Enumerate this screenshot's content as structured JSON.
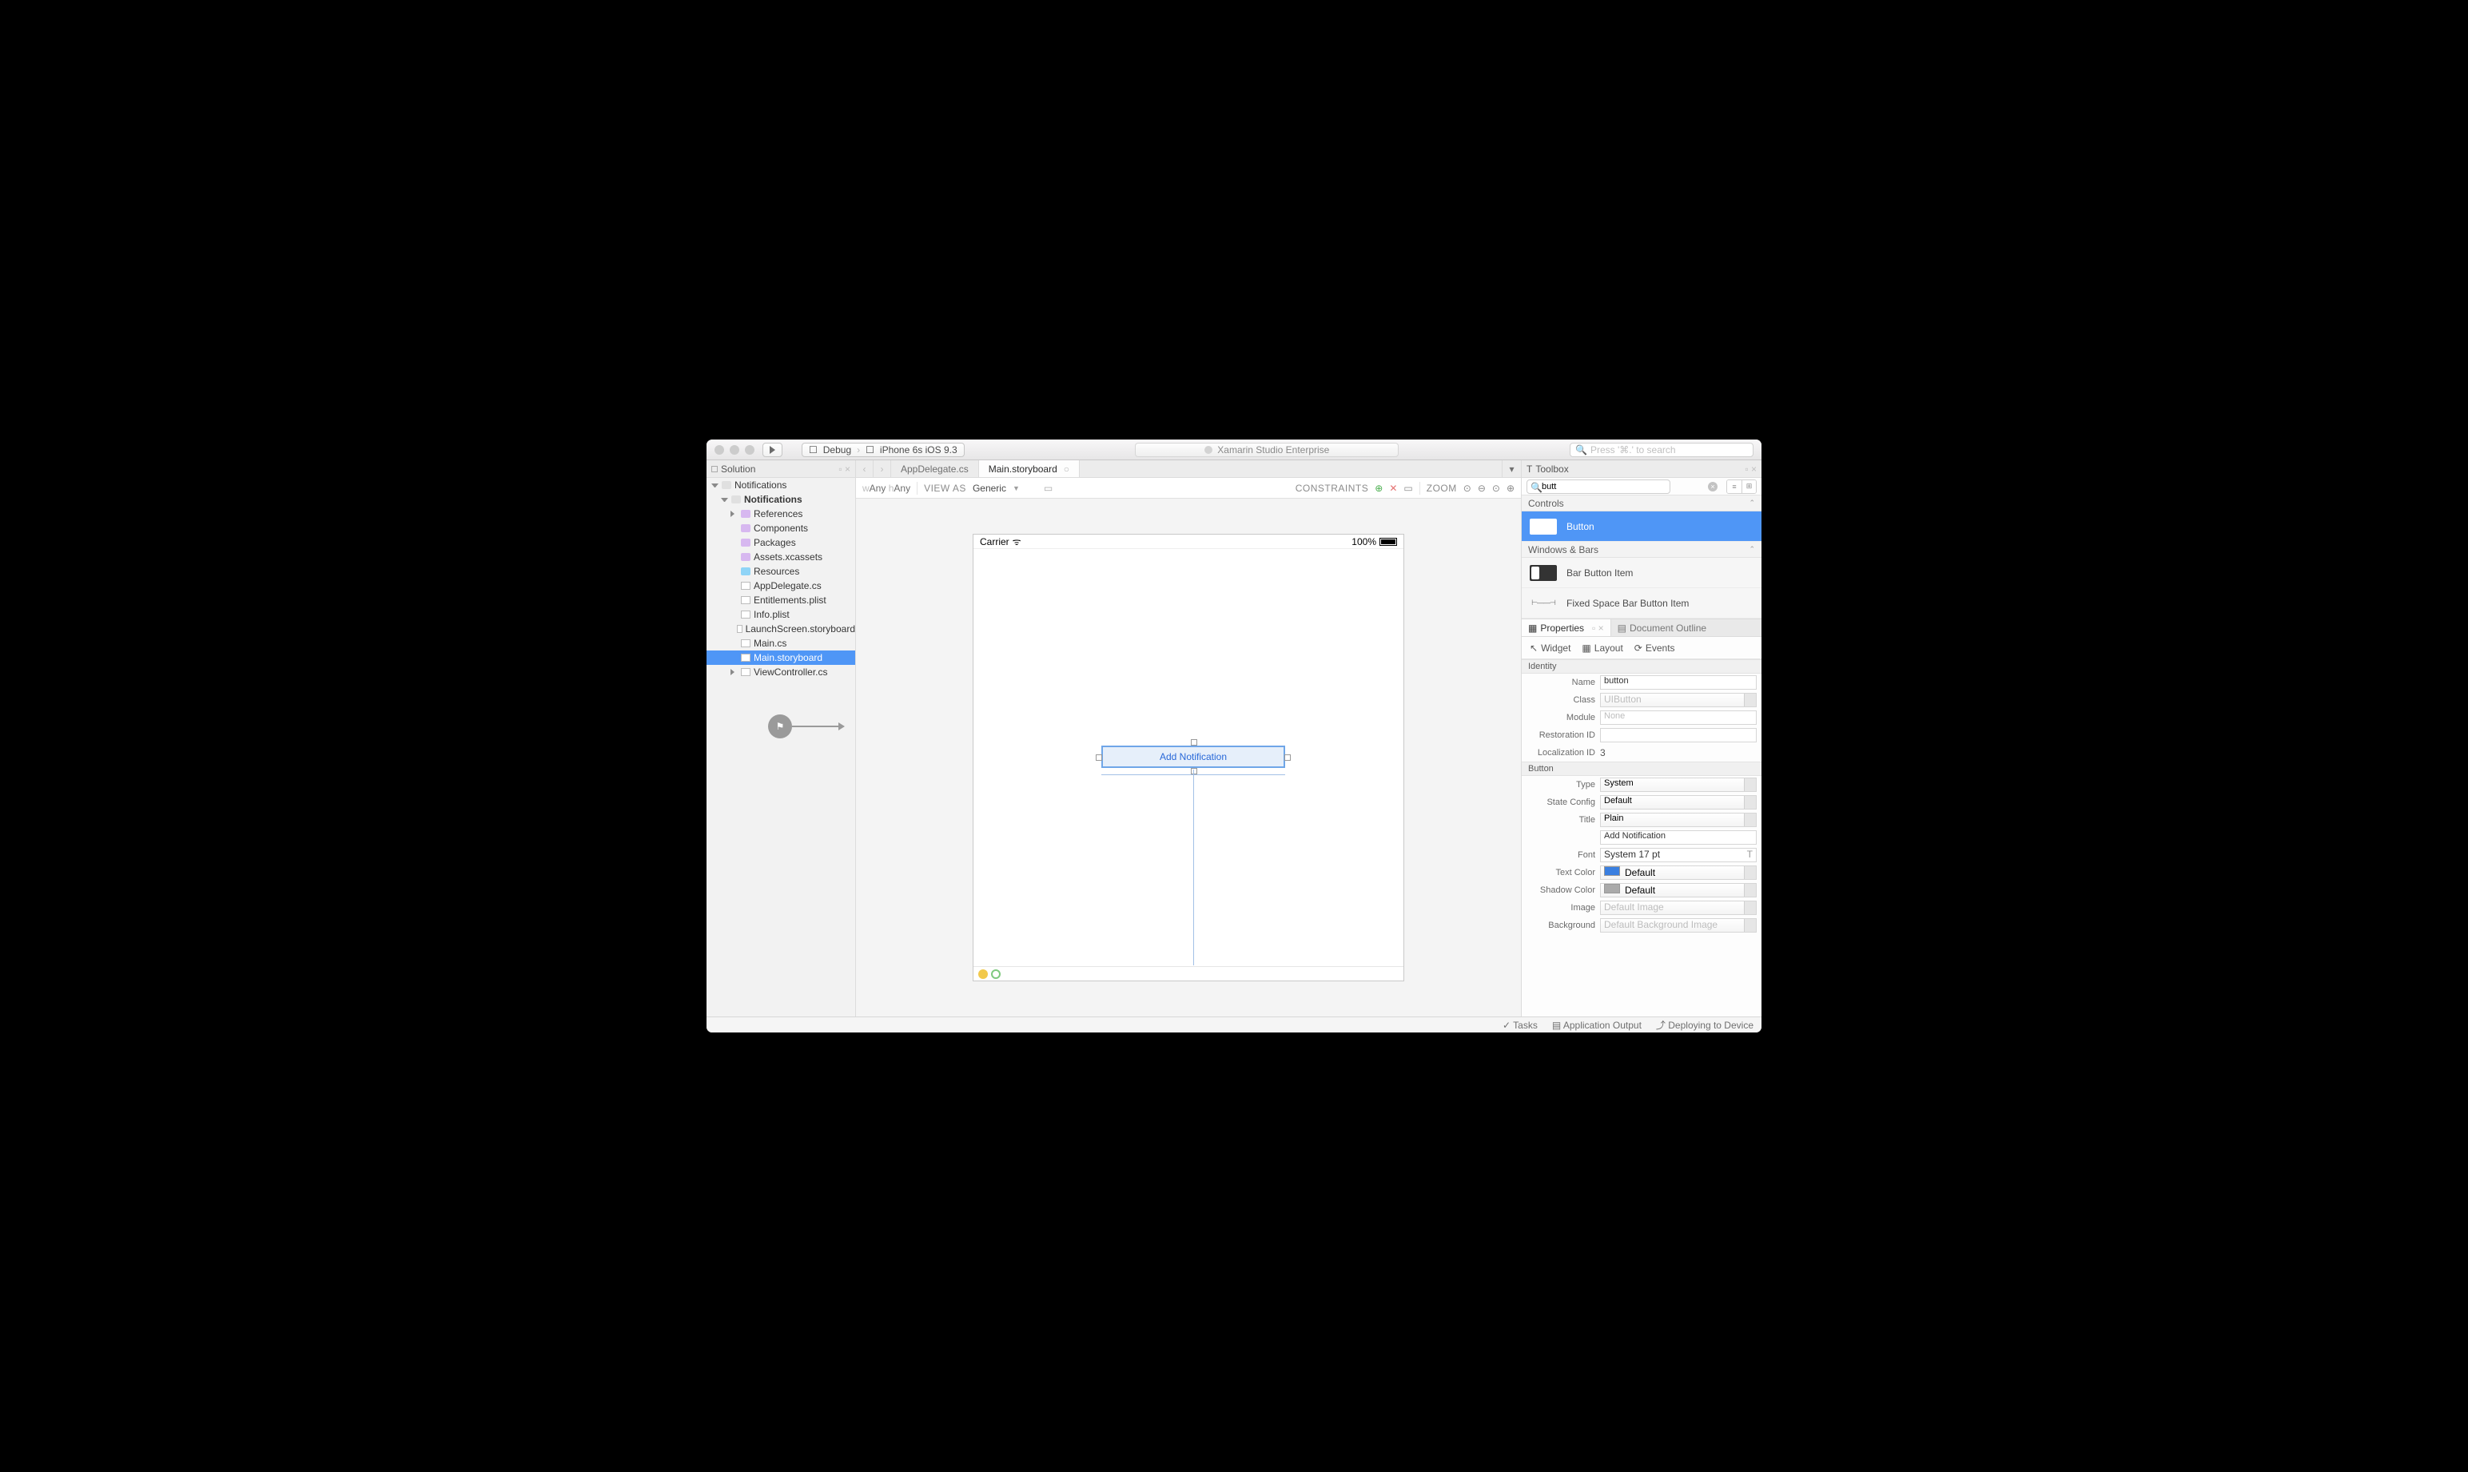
{
  "titlebar": {
    "config": "Debug",
    "target": "iPhone 6s iOS 9.3",
    "lcd": "Xamarin Studio Enterprise",
    "search_placeholder": "Press '⌘.' to search"
  },
  "solution": {
    "title": "Solution",
    "proj": "Notifications",
    "projbold": "Notifications",
    "items": [
      {
        "label": "References",
        "t": "foldp",
        "arrow": "cl",
        "lvl": 2
      },
      {
        "label": "Components",
        "t": "foldp",
        "lvl": 2
      },
      {
        "label": "Packages",
        "t": "foldp",
        "lvl": 2
      },
      {
        "label": "Assets.xcassets",
        "t": "foldp",
        "lvl": 2
      },
      {
        "label": "Resources",
        "t": "fold",
        "lvl": 2
      },
      {
        "label": "AppDelegate.cs",
        "t": "file",
        "lvl": 2
      },
      {
        "label": "Entitlements.plist",
        "t": "file",
        "lvl": 2
      },
      {
        "label": "Info.plist",
        "t": "file",
        "lvl": 2
      },
      {
        "label": "LaunchScreen.storyboard",
        "t": "file",
        "lvl": 2
      },
      {
        "label": "Main.cs",
        "t": "file",
        "lvl": 2
      },
      {
        "label": "Main.storyboard",
        "t": "file",
        "lvl": 2,
        "sel": true
      },
      {
        "label": "ViewController.cs",
        "t": "file",
        "lvl": 2,
        "arrow": "cl"
      }
    ]
  },
  "tabs": {
    "a": "AppDelegate.cs",
    "b": "Main.storyboard"
  },
  "design": {
    "wAny": "wAny",
    "hAny": "hAny",
    "viewas": "VIEW AS",
    "generic": "Generic",
    "constraints": "CONSTRAINTS",
    "zoom": "ZOOM"
  },
  "device": {
    "carrier": "Carrier",
    "battery": "100%",
    "button": "Add Notification"
  },
  "toolbox": {
    "title": "Toolbox",
    "search": "butt",
    "cat1": "Controls",
    "cat2": "Windows & Bars",
    "it": [
      {
        "label": "Button"
      },
      {
        "label": "Bar Button Item"
      },
      {
        "label": "Fixed Space Bar Button Item"
      }
    ]
  },
  "props": {
    "ptitle": "Properties",
    "dtitle": "Document Outline",
    "sub": [
      "Widget",
      "Layout",
      "Events"
    ],
    "g_identity": "Identity",
    "g_button": "Button",
    "name_l": "Name",
    "name_v": "button",
    "class_l": "Class",
    "class_v": "UIButton",
    "module_l": "Module",
    "module_v": "None",
    "rest_l": "Restoration ID",
    "rest_v": "",
    "loc_l": "Localization ID",
    "loc_v": "3",
    "type_l": "Type",
    "type_v": "System",
    "state_l": "State Config",
    "state_v": "Default",
    "title_l": "Title",
    "title_v": "Plain",
    "title2_v": "Add Notification",
    "font_l": "Font",
    "font_v": "System 17 pt",
    "tcolor_l": "Text Color",
    "tcolor_v": "Default",
    "scolor_l": "Shadow Color",
    "scolor_v": "Default",
    "img_l": "Image",
    "img_v": "Default Image",
    "bg_l": "Background",
    "bg_v": "Default Background Image"
  },
  "footer": {
    "tasks": "Tasks",
    "out": "Application Output",
    "dep": "Deploying to Device"
  }
}
